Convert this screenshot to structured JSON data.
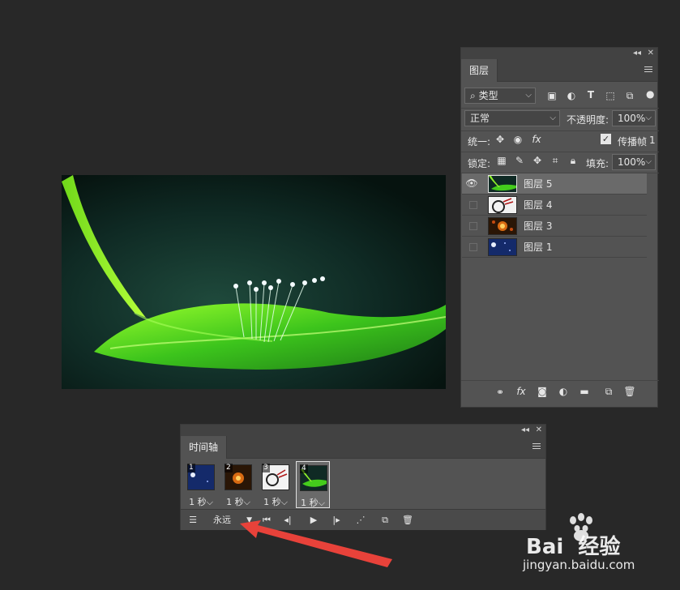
{
  "layers_panel": {
    "tab_label": "图层",
    "filter_label": "类型",
    "blend_mode": "正常",
    "opacity_label": "不透明度:",
    "opacity_value": "100%",
    "unify_label": "统一:",
    "propagate_label": "传播帧",
    "propagate_value": "1",
    "lock_label": "锁定:",
    "fill_label": "填充:",
    "fill_value": "100%",
    "layers": [
      {
        "name": "图层 5",
        "visible": true,
        "selected": true,
        "thumb": "leaf"
      },
      {
        "name": "图层 4",
        "visible": false,
        "selected": false,
        "thumb": "dandelion"
      },
      {
        "name": "图层 3",
        "visible": false,
        "selected": false,
        "thumb": "fireworks"
      },
      {
        "name": "图层 1",
        "visible": false,
        "selected": false,
        "thumb": "night-sky"
      }
    ]
  },
  "timeline_panel": {
    "tab_label": "时间轴",
    "frames": [
      {
        "number": "1",
        "duration": "1 秒",
        "thumb": "night-sky"
      },
      {
        "number": "2",
        "duration": "1 秒",
        "thumb": "fireworks"
      },
      {
        "number": "3",
        "duration": "1 秒",
        "thumb": "dandelion"
      },
      {
        "number": "4",
        "duration": "1 秒",
        "thumb": "leaf"
      }
    ],
    "loop_value": "永远"
  },
  "watermark": {
    "brand_text": "Bai  经验",
    "url_text": "jingyan.baidu.com"
  },
  "colors": {
    "app_bg": "#282828",
    "panel_bg": "#535353",
    "selected_row": "#6a6a6a",
    "annotation_arrow": "#e8423a"
  }
}
